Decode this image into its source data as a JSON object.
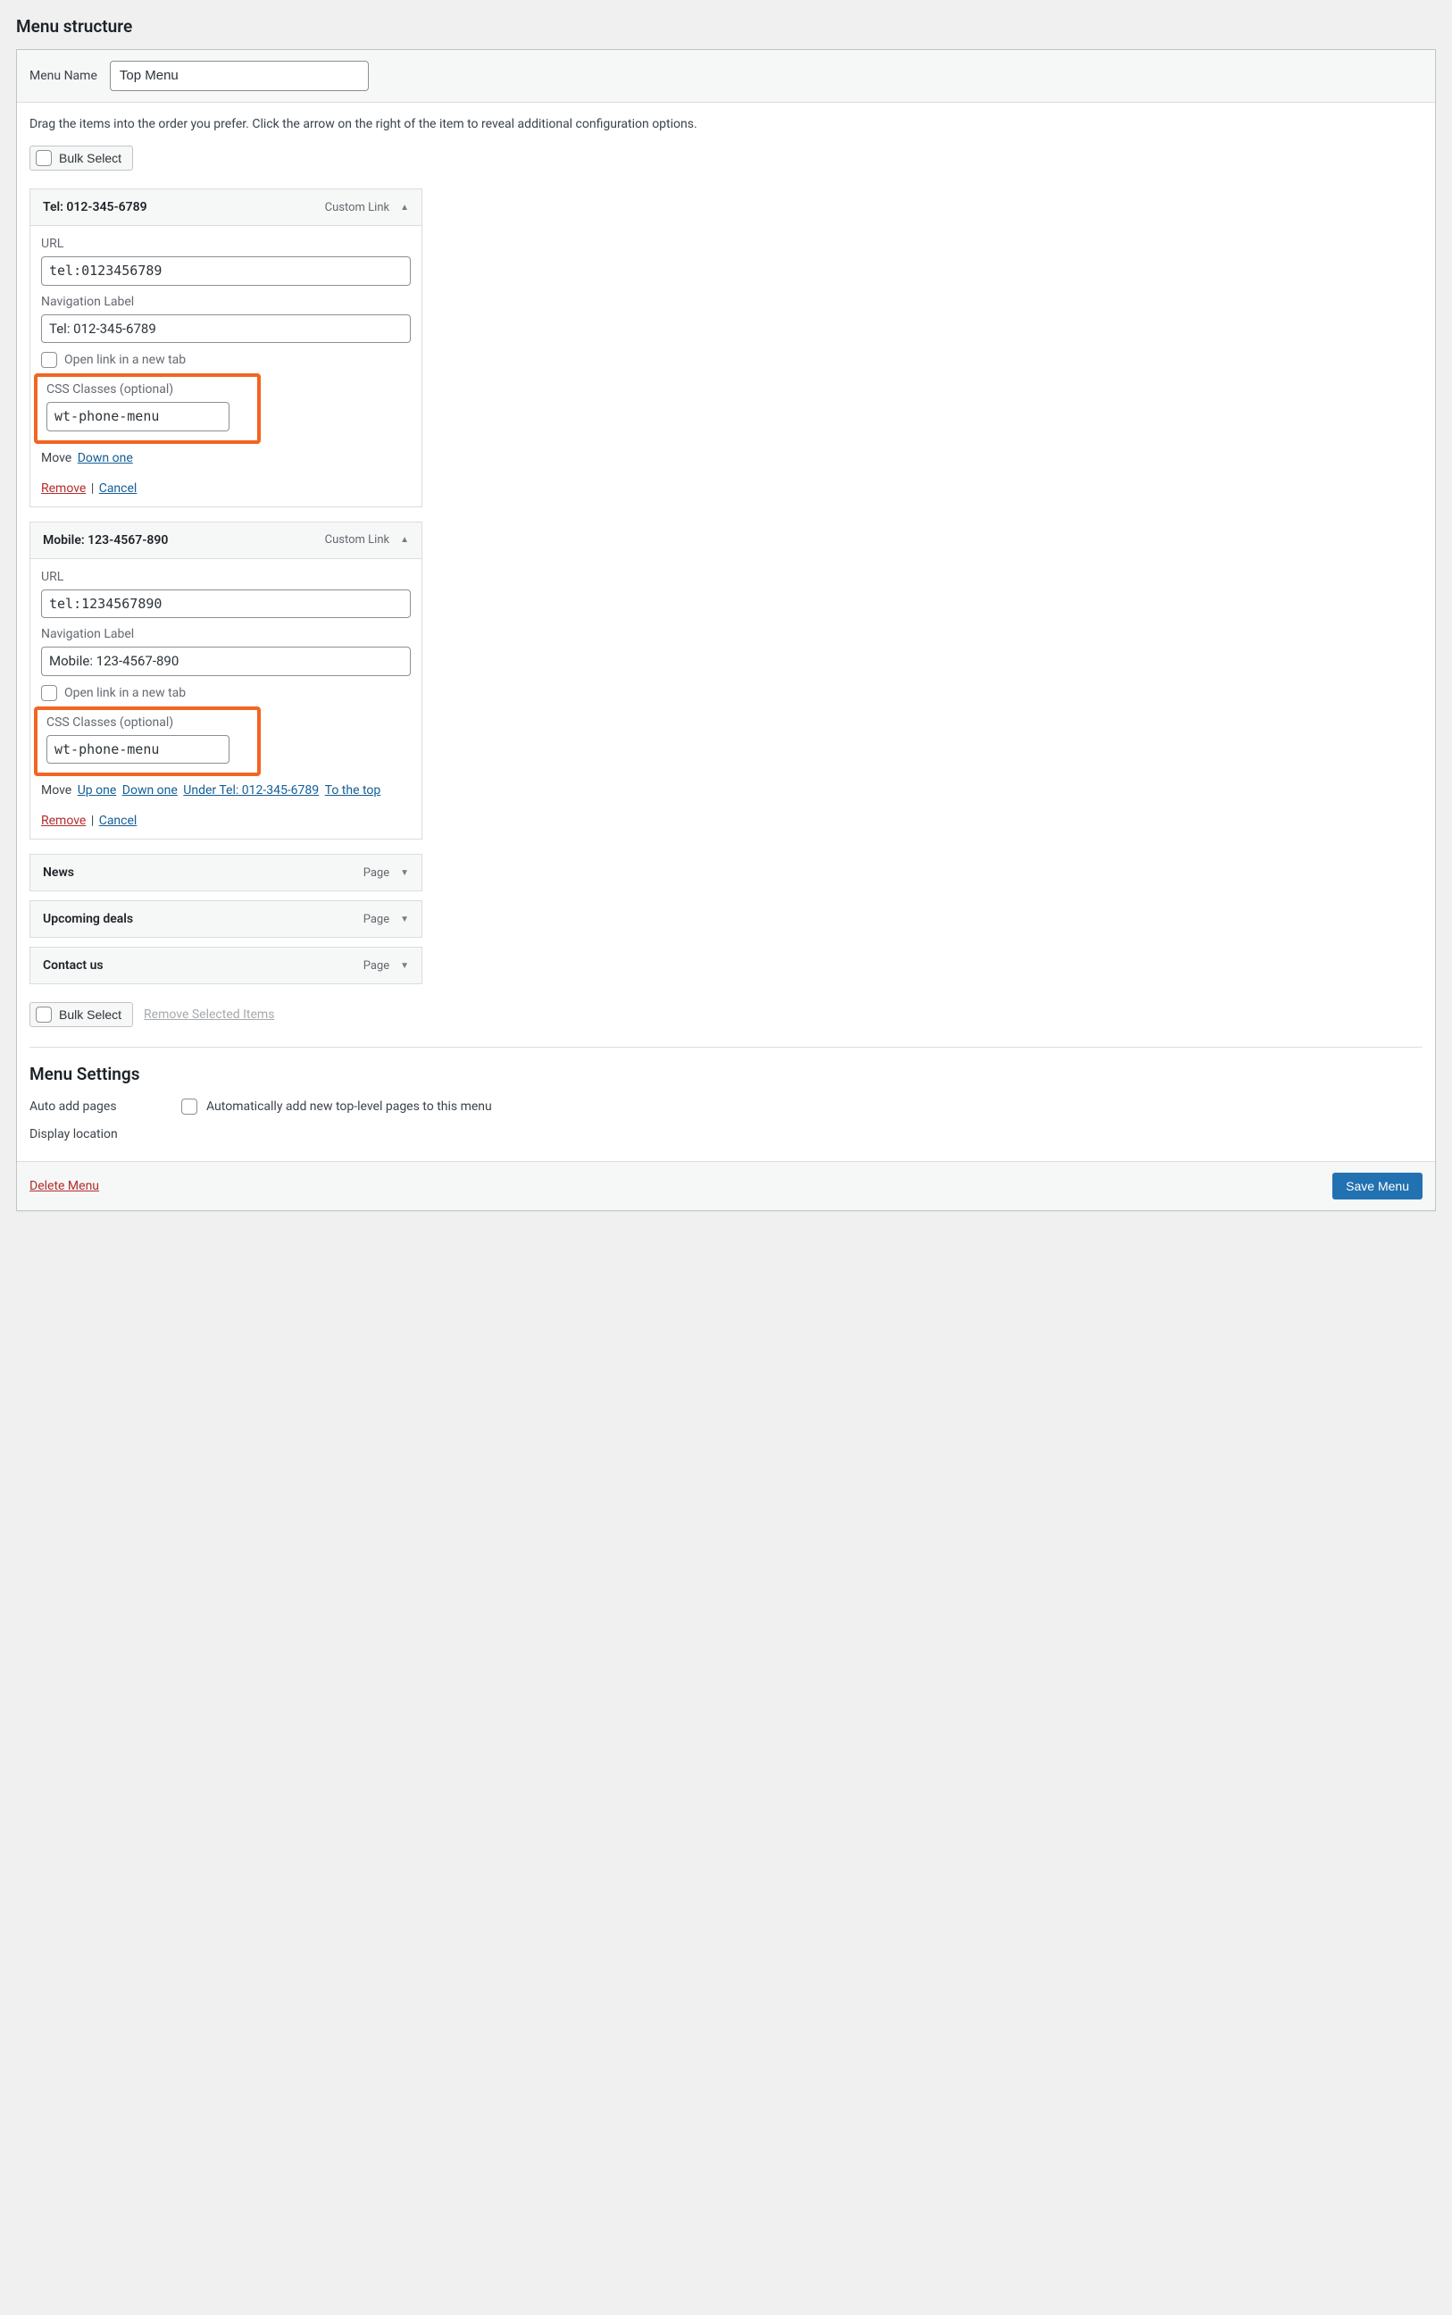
{
  "section_heading": "Menu structure",
  "menu_name": {
    "label": "Menu Name",
    "value": "Top Menu"
  },
  "instructions": "Drag the items into the order you prefer. Click the arrow on the right of the item to reveal additional configuration options.",
  "bulk_select": "Bulk Select",
  "remove_selected": "Remove Selected Items",
  "labels": {
    "url": "URL",
    "nav_label": "Navigation Label",
    "open_new_tab": "Open link in a new tab",
    "css_classes": "CSS Classes (optional)",
    "move": "Move",
    "custom_link": "Custom Link",
    "page": "Page",
    "remove": "Remove",
    "cancel": "Cancel"
  },
  "move_links": {
    "down_one": "Down one",
    "up_one": "Up one",
    "under_b": "Under Tel: 012-345-6789",
    "to_top": "To the top"
  },
  "items": {
    "a": {
      "title": "Tel: 012-345-6789",
      "url": "tel:0123456789",
      "nav_label": "Tel: 012-345-6789",
      "css": "wt-phone-menu"
    },
    "b": {
      "title": "Mobile: 123-4567-890",
      "url": "tel:1234567890",
      "nav_label": "Mobile: 123-4567-890",
      "css": "wt-phone-menu"
    },
    "c": {
      "title": "News"
    },
    "d": {
      "title": "Upcoming deals"
    },
    "e": {
      "title": "Contact us"
    }
  },
  "settings": {
    "heading": "Menu Settings",
    "auto_add": {
      "label": "Auto add pages",
      "checkbox": "Automatically add new top-level pages to this menu"
    },
    "display_location": {
      "label": "Display location"
    }
  },
  "footer": {
    "delete": "Delete Menu",
    "save": "Save Menu"
  }
}
